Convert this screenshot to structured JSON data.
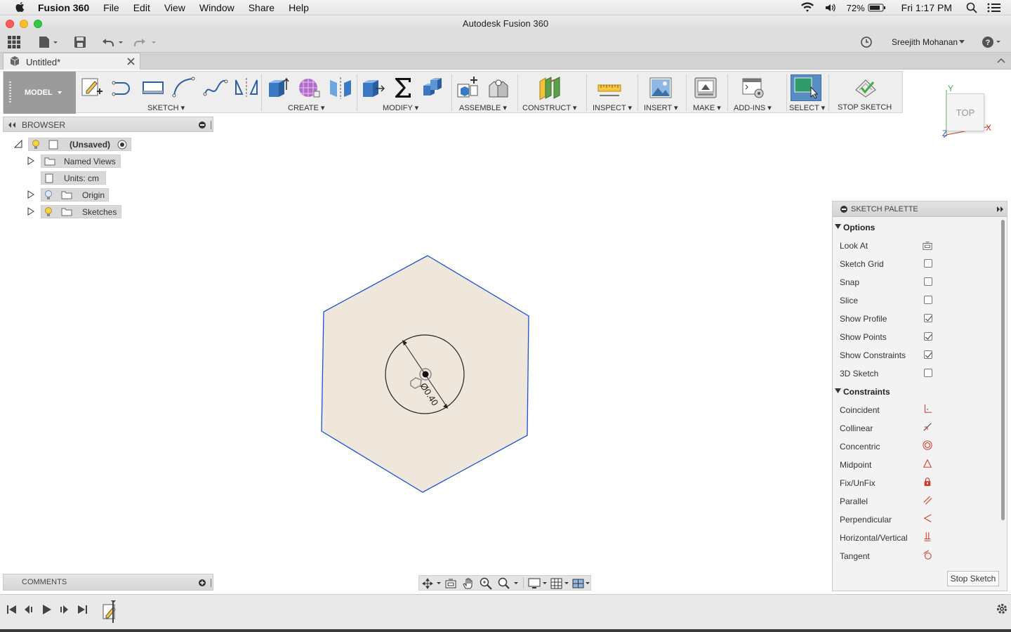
{
  "menubar": {
    "app_name": "Fusion 360",
    "items": [
      "File",
      "Edit",
      "View",
      "Window",
      "Share",
      "Help"
    ],
    "battery": "72%",
    "clock": "Fri 1:17 PM"
  },
  "window": {
    "title": "Autodesk Fusion 360"
  },
  "quick_access": {
    "user": "Sreejith Mohanan"
  },
  "document_tab": {
    "label": "Untitled*"
  },
  "ribbon": {
    "workspace": "MODEL",
    "groups": [
      "SKETCH",
      "CREATE",
      "MODIFY",
      "ASSEMBLE",
      "CONSTRUCT",
      "INSPECT",
      "INSERT",
      "MAKE",
      "ADD-INS",
      "SELECT",
      "STOP SKETCH"
    ]
  },
  "browser": {
    "title": "BROWSER",
    "nodes": [
      "(Unsaved)",
      "Named Views",
      "Units: cm",
      "Origin",
      "Sketches"
    ]
  },
  "viewcube": {
    "face": "TOP",
    "axis_x": "X",
    "axis_y": "Y",
    "axis_z": "Z"
  },
  "sketch": {
    "dimension": "Ø0.40"
  },
  "palette": {
    "title": "SKETCH PALETTE",
    "options_title": "Options",
    "options": [
      {
        "label": "Look At",
        "control": "look-at-icon"
      },
      {
        "label": "Sketch Grid",
        "checked": false
      },
      {
        "label": "Snap",
        "checked": false
      },
      {
        "label": "Slice",
        "checked": false
      },
      {
        "label": "Show Profile",
        "checked": true
      },
      {
        "label": "Show Points",
        "checked": true
      },
      {
        "label": "Show Constraints",
        "checked": true
      },
      {
        "label": "3D Sketch",
        "checked": false
      }
    ],
    "constraints_title": "Constraints",
    "constraints": [
      {
        "label": "Coincident",
        "icon": "coincident-icon"
      },
      {
        "label": "Collinear",
        "icon": "collinear-icon"
      },
      {
        "label": "Concentric",
        "icon": "concentric-icon"
      },
      {
        "label": "Midpoint",
        "icon": "midpoint-icon"
      },
      {
        "label": "Fix/UnFix",
        "icon": "lock-icon"
      },
      {
        "label": "Parallel",
        "icon": "parallel-icon"
      },
      {
        "label": "Perpendicular",
        "icon": "perpendicular-icon"
      },
      {
        "label": "Horizontal/Vertical",
        "icon": "horizontal-vertical-icon"
      },
      {
        "label": "Tangent",
        "icon": "tangent-icon"
      }
    ],
    "stop_button": "Stop Sketch"
  },
  "comments": {
    "title": "COMMENTS"
  },
  "colors": {
    "accent": "#4a7fb5",
    "sketch_line": "#1d4fd8",
    "profile_fill": "#efe6dc",
    "constraint_red": "#d33a2c"
  }
}
